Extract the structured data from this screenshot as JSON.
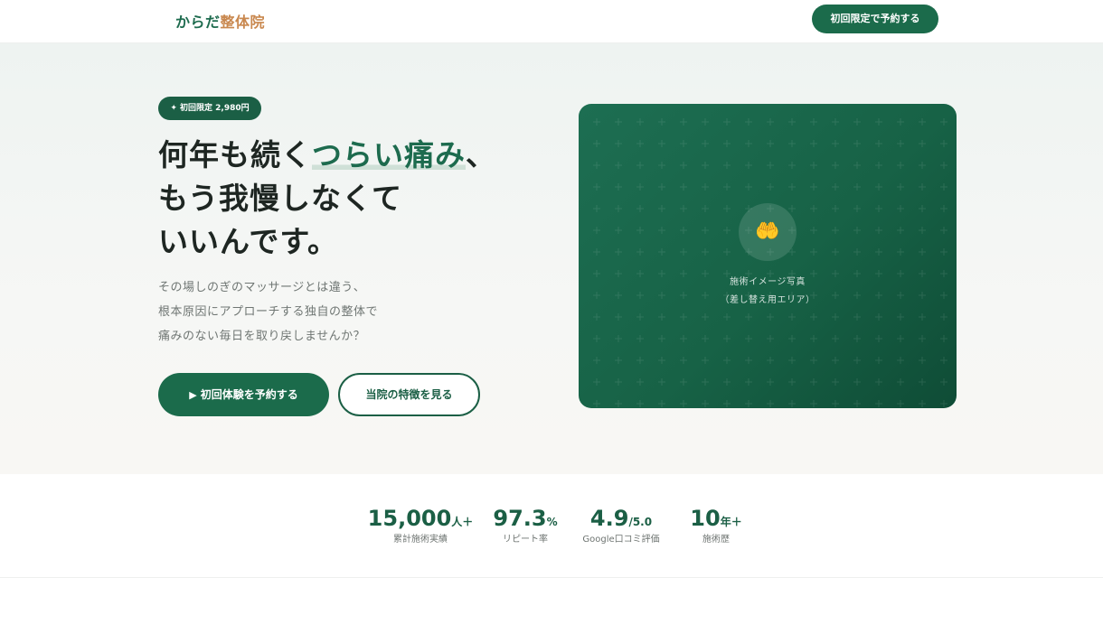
{
  "header": {
    "logo_part1": "からだ",
    "logo_part2": "整体院",
    "cta_label": "初回限定で予約する"
  },
  "hero": {
    "badge": "✦ 初回限定 2,980円",
    "headline_pre": "何年も続く",
    "headline_accent": "つらい痛み",
    "headline_post": "、",
    "headline_line2": "もう我慢しなくて",
    "headline_line3": "いいんです。",
    "lead_line1": "その場しのぎのマッサージとは違う、",
    "lead_line2": "根本原因にアプローチする独自の整体で",
    "lead_line3": "痛みのない毎日を取り戻しませんか？",
    "primary_button": "初回体験を予約する",
    "primary_button_icon": "▶",
    "secondary_button": "当院の特徴を見る",
    "image_icon": "🤲",
    "image_caption_line1": "施術イメージ写真",
    "image_caption_line2": "（差し替え用エリア）"
  },
  "stats": [
    {
      "value": "15,000",
      "unit": "人＋",
      "label": "累計施術実績"
    },
    {
      "value": "97.3",
      "unit": "%",
      "label": "リピート率"
    },
    {
      "value": "4.9",
      "unit": "/5.0",
      "label": "Google口コミ評価"
    },
    {
      "value": "10",
      "unit": "年＋",
      "label": "施術歴"
    }
  ],
  "colors": {
    "brand_green": "#1b6b4b",
    "accent_orange": "#c9884f"
  }
}
